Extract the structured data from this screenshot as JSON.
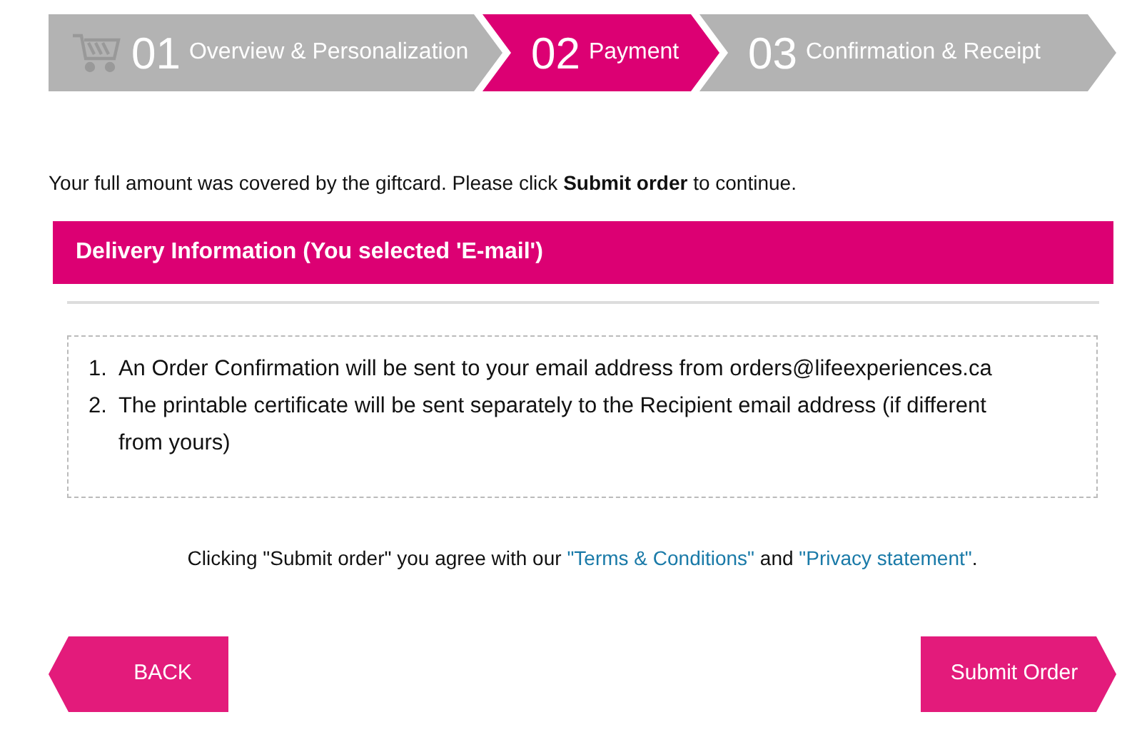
{
  "steps": [
    {
      "number": "01",
      "label": "Overview & Personalization",
      "selected": false
    },
    {
      "number": "02",
      "label": "Payment",
      "selected": true
    },
    {
      "number": "03",
      "label": "Confirmation & Receipt",
      "selected": false
    }
  ],
  "intro": "Your full amount was covered by the giftcard. Please click **Submit order** to continue.",
  "delivery": {
    "title": "Delivery Information (You selected 'E-mail')",
    "items": [
      {
        "marker": "1.",
        "text": "An Order Confirmation will be sent to your email address from orders@lifeexperiences.ca"
      },
      {
        "marker": "2.",
        "text": "The printable certificate will be sent separately to the Recipient email address (if different from yours)"
      }
    ]
  },
  "agreement": {
    "before": "Clicking \"Submit order\" you agree with our",
    "terms_link": "\"Terms & Conditions\"",
    "middle": "and",
    "privacy_link": "\"Privacy statement\"",
    "after": "."
  },
  "buttons": {
    "back": "BACK",
    "submit": "Submit Order"
  }
}
